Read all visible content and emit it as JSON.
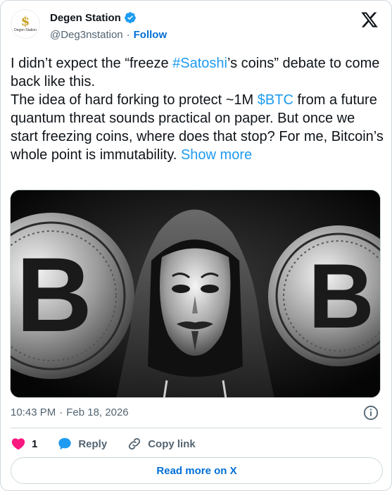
{
  "author": {
    "display_name": "Degen Station",
    "handle": "@Deg3nstation",
    "separator": "·",
    "follow_label": "Follow",
    "avatar_glyph": "$",
    "avatar_text": "Degen Station"
  },
  "tweet": {
    "text_1": "I didn’t expect the “freeze ",
    "hashtag": "#Satoshi",
    "text_2": "’s coins” debate to come back like this.\nThe idea of hard forking to protect ~1M ",
    "cashtag": "$BTC",
    "text_3": " from a future quantum threat sounds practical on paper. But once we start freezing coins, where does that stop? For me, Bitcoin’s whole point is immutability. ",
    "show_more": "Show more"
  },
  "media": {
    "coin_glyph": "B"
  },
  "footer": {
    "time": "10:43 PM",
    "separator": "·",
    "date": "Feb 18, 2026"
  },
  "actions": {
    "like_count": "1",
    "reply_label": "Reply",
    "copy_link_label": "Copy link"
  },
  "read_more_label": "Read more on X",
  "colors": {
    "accent": "#1d9bf0",
    "follow": "#006fd6",
    "like": "#f91880",
    "muted": "#536471"
  }
}
